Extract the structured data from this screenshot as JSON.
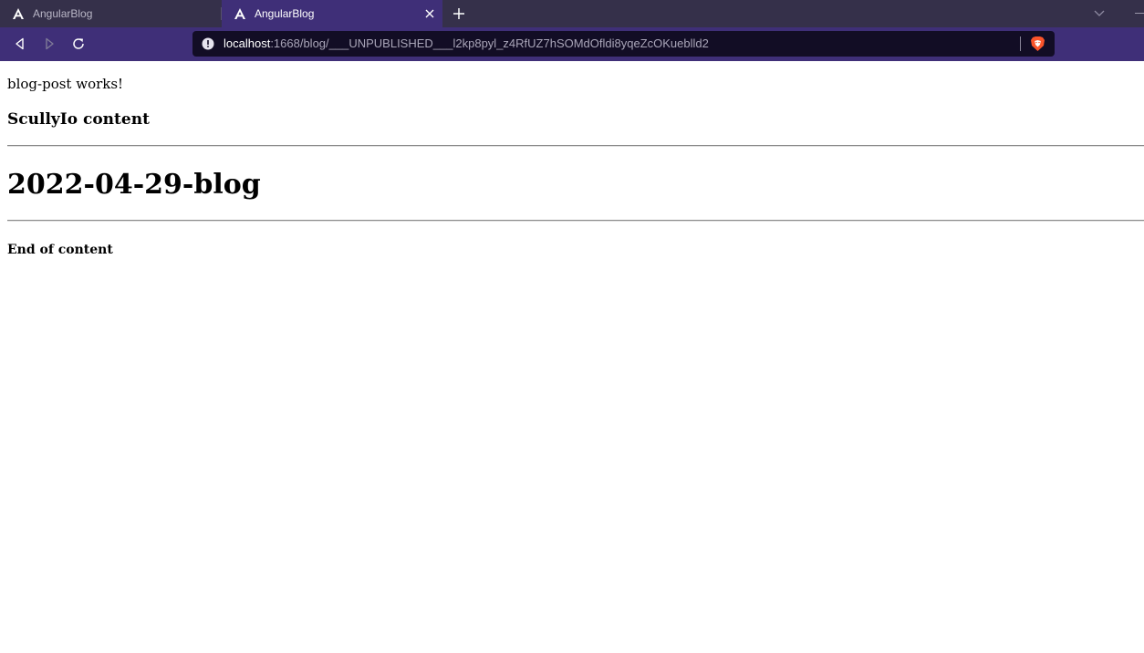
{
  "browser": {
    "tabs": [
      {
        "title": "AngularBlog",
        "active": false
      },
      {
        "title": "AngularBlog",
        "active": true
      }
    ],
    "address": {
      "host": "localhost",
      "path": ":1668/blog/___UNPUBLISHED___l2kp8pyl_z4RfUZ7hSOMdOfldi8yqeZcOKueblld2"
    },
    "colors": {
      "tabstrip": "#35304a",
      "toolbar": "#3f2f78",
      "urlbar": "#120d25",
      "brave_orange": "#fb542b"
    },
    "icons": {
      "favicon": "angular-icon",
      "new_tab": "plus-icon",
      "tab_list": "chevron-down-icon",
      "back": "back-icon",
      "forward": "forward-icon",
      "reload": "reload-icon",
      "site_info": "info-icon",
      "shields": "brave-lion-icon"
    }
  },
  "page": {
    "intro": "blog-post works!",
    "section_title": "ScullyIo content",
    "post_title": "2022-04-29-blog",
    "footer": "End of content"
  }
}
